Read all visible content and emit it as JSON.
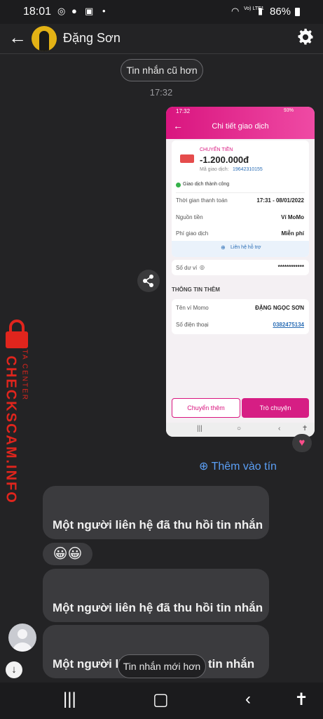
{
  "status_bar": {
    "time": "18:01",
    "network": "Vo) LTE1",
    "battery": "86%"
  },
  "header": {
    "contact_name": "Đặng Sơn"
  },
  "thread": {
    "older_pill": "Tin nhắn cũ hơn",
    "timestamp": "17:32",
    "add_to_chat": "Thêm vào tín",
    "recalled_1": "Một người liên hệ đã thu hồi tin nhắn",
    "emoji": "😀😀",
    "recalled_2": "Một người liên hệ đã thu hồi tin nhắn",
    "recalled_3_prefix": "Một người li",
    "recalled_3_suffix": "tin nhắn",
    "newer_pill": "Tin nhắn mới hơn",
    "reaction": "♥"
  },
  "shared_image": {
    "status_time": "17:32",
    "status_pct": "93%",
    "title": "Chi tiết giao dịch",
    "type_label": "CHUYỂN TIỀN",
    "amount": "-1.200.000đ",
    "txn_code_label": "Mã giao dịch:",
    "txn_code": "19642310155",
    "status": "Giao dịch thành công",
    "rows": [
      {
        "label": "Thời gian thanh toán",
        "value": "17:31 - 08/01/2022"
      },
      {
        "label": "Nguồn tiền",
        "value": "Ví MoMo"
      },
      {
        "label": "Phí giao dịch",
        "value": "Miễn phí"
      }
    ],
    "support": "Liên hệ hỗ trợ",
    "balance_label": "Số dư ví",
    "balance_value": "************",
    "more_info_title": "THÔNG TIN THÊM",
    "wallet_name_label": "Tên ví Momo",
    "wallet_name": "ĐẶNG NGỌC SƠN",
    "phone_label": "Số điện thoại",
    "phone": "0382475134",
    "btn_transfer": "Chuyển thêm",
    "btn_chat": "Trò chuyện"
  },
  "watermark": {
    "brand": "CHECKSCAM.INFO",
    "sub": "DATA CENTER"
  },
  "colors": {
    "accent": "#5b9ff5",
    "momo": "#d61e84",
    "watermark": "#e0251d"
  }
}
